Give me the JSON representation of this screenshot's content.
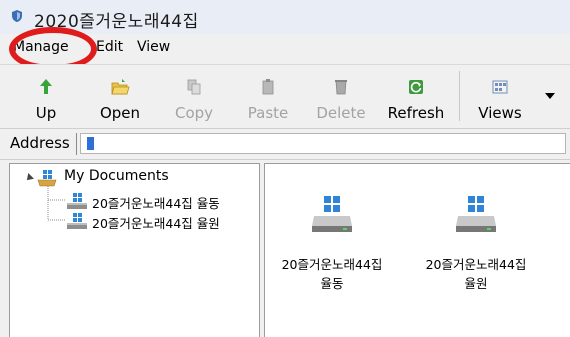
{
  "window": {
    "title": "2020즐거운노래44집"
  },
  "menu": {
    "items": [
      "Manage",
      "Edit",
      "View"
    ]
  },
  "toolbar": {
    "buttons": [
      {
        "label": "Up",
        "icon": "up-arrow-icon",
        "enabled": true
      },
      {
        "label": "Open",
        "icon": "open-folder-icon",
        "enabled": true
      },
      {
        "label": "Copy",
        "icon": "copy-icon",
        "enabled": false
      },
      {
        "label": "Paste",
        "icon": "paste-icon",
        "enabled": false
      },
      {
        "label": "Delete",
        "icon": "delete-icon",
        "enabled": false
      },
      {
        "label": "Refresh",
        "icon": "refresh-icon",
        "enabled": true
      },
      {
        "label": "Views",
        "icon": "views-icon",
        "enabled": true
      }
    ]
  },
  "address": {
    "label": "Address",
    "value": ""
  },
  "tree": {
    "root": "My Documents",
    "children": [
      "20즐거운노래44집 율동",
      "20즐거운노래44집 율원"
    ]
  },
  "content": {
    "items": [
      {
        "line1": "20즐거운노래44집",
        "line2": "율동"
      },
      {
        "line1": "20즐거운노래44집",
        "line2": "율원"
      }
    ]
  },
  "colors": {
    "annotation": "#e01b1b",
    "accent": "#2f6fd8"
  }
}
